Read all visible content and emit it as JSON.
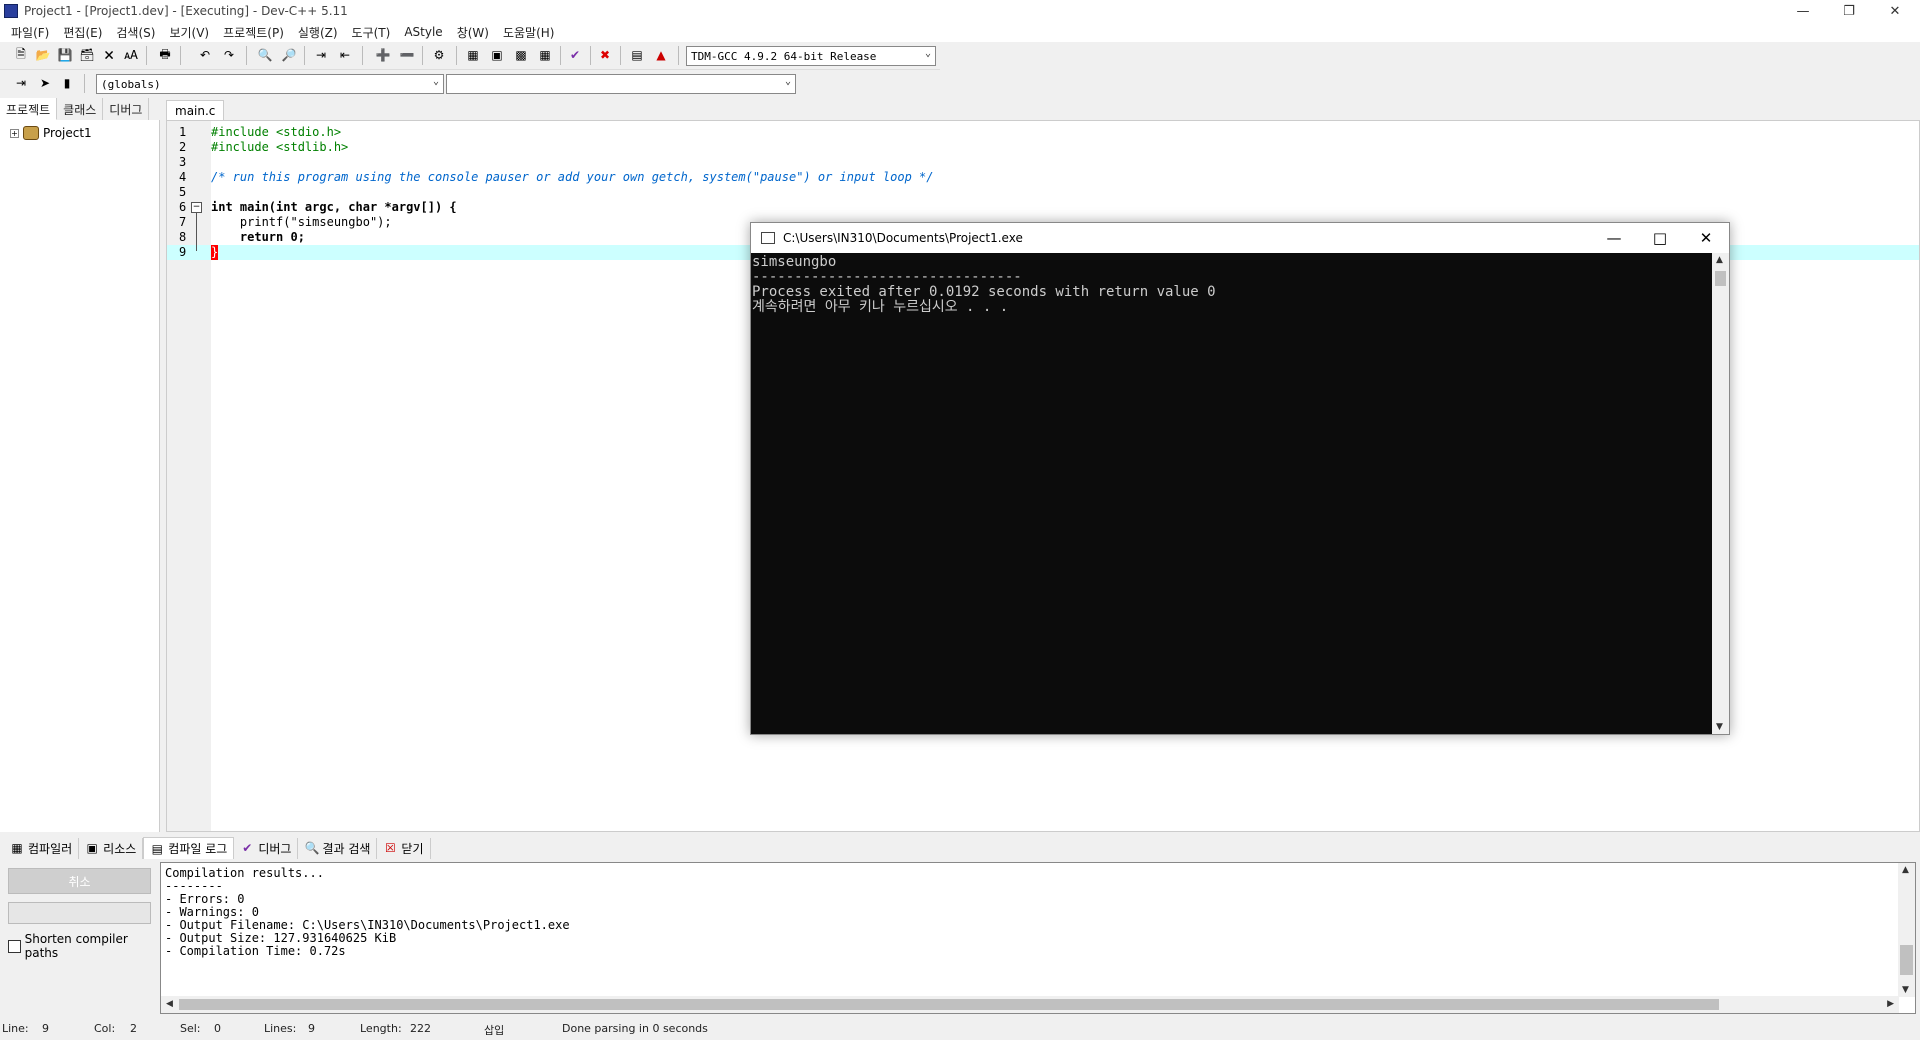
{
  "window": {
    "title": "Project1 - [Project1.dev] - [Executing] - Dev-C++ 5.11"
  },
  "menu": [
    "파일(F)",
    "편집(E)",
    "검색(S)",
    "보기(V)",
    "프로젝트(P)",
    "실행(Z)",
    "도구(T)",
    "AStyle",
    "창(W)",
    "도움말(H)"
  ],
  "toolbar": {
    "compiler_select": "TDM-GCC 4.9.2 64-bit Release",
    "scope_select": "(globals)",
    "member_select": ""
  },
  "left_tabs": [
    "프로젝트",
    "클래스",
    "디버그"
  ],
  "project_tree": {
    "root": "Project1"
  },
  "editor": {
    "tab": "main.c",
    "lines": [
      {
        "n": "1",
        "text": "#include <stdio.h>"
      },
      {
        "n": "2",
        "text": "#include <stdlib.h>"
      },
      {
        "n": "3",
        "text": ""
      },
      {
        "n": "4",
        "text": "/* run this program using the console pauser or add your own getch, system(\"pause\") or input loop */"
      },
      {
        "n": "5",
        "text": ""
      },
      {
        "n": "6",
        "text": "int main(int argc, char *argv[]) {"
      },
      {
        "n": "7",
        "text": "    printf(\"simseungbo\");"
      },
      {
        "n": "8",
        "text": "    return 0;"
      },
      {
        "n": "9",
        "text": "}"
      }
    ]
  },
  "console": {
    "title": "C:\\Users\\IN310\\Documents\\Project1.exe",
    "output": "simseungbo\n--------------------------------\nProcess exited after 0.0192 seconds with return value 0\n계속하려면 아무 키나 누르십시오 . . ."
  },
  "bottom_tabs": [
    "컴파일러",
    "리소스",
    "컴파일 로그",
    "디버그",
    "결과 검색",
    "닫기"
  ],
  "bottom_left": {
    "abort_label": "취소",
    "shorten_label": "Shorten compiler paths"
  },
  "compile_log": "Compilation results...\n--------\n- Errors: 0\n- Warnings: 0\n- Output Filename: C:\\Users\\IN310\\Documents\\Project1.exe\n- Output Size: 127.931640625 KiB\n- Compilation Time: 0.72s",
  "status": {
    "line_label": "Line:",
    "line": "9",
    "col_label": "Col:",
    "col": "2",
    "sel_label": "Sel:",
    "sel": "0",
    "lines_label": "Lines:",
    "lines": "9",
    "length_label": "Length:",
    "length": "222",
    "mode": "삽입",
    "message": "Done parsing in 0 seconds"
  }
}
